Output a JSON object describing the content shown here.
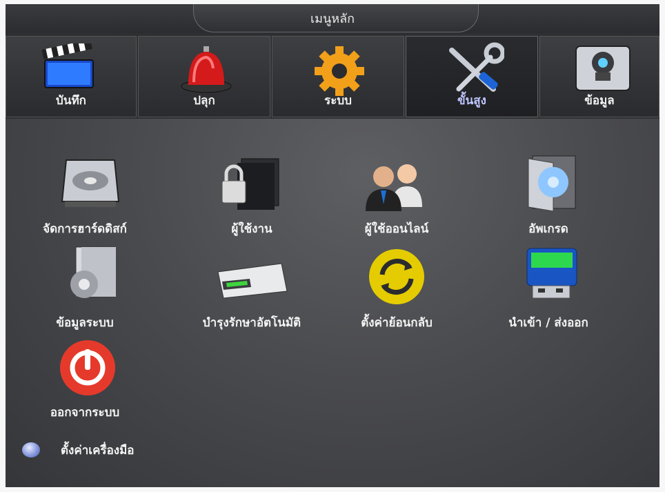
{
  "window": {
    "title": "เมนูหลัก"
  },
  "tabs": [
    {
      "label": "บันทึก",
      "icon": "clapperboard-icon"
    },
    {
      "label": "ปลุก",
      "icon": "siren-icon"
    },
    {
      "label": "ระบบ",
      "icon": "gear-icon"
    },
    {
      "label": "ขั้นสูง",
      "icon": "tools-icon",
      "active": true
    },
    {
      "label": "ข้อมูล",
      "icon": "disk-info-icon"
    }
  ],
  "items": [
    {
      "label": "จัดการฮาร์ดดิสก์",
      "icon": "hard-disk-icon"
    },
    {
      "label": "ผู้ใช้งาน",
      "icon": "lock-folder-icon"
    },
    {
      "label": "ผู้ใช้ออนไลน์",
      "icon": "users-icon"
    },
    {
      "label": "อัพเกรด",
      "icon": "cd-upgrade-icon"
    },
    {
      "label": "ข้อมูลระบบ",
      "icon": "system-info-icon"
    },
    {
      "label": "บำรุงรักษาอัตโนมัติ",
      "icon": "drive-maintenance-icon"
    },
    {
      "label": "ตั้งค่าย้อนกลับ",
      "icon": "restore-icon"
    },
    {
      "label": "นำเข้า / ส่งออก",
      "icon": "usb-drive-icon"
    },
    {
      "label": "ออกจากระบบ",
      "icon": "power-icon"
    }
  ],
  "footer": {
    "tools_label": "ตั้งค่าเครื่องมือ",
    "icon": "info-dot-icon"
  },
  "colors": {
    "active_tab_text": "#bfc7ff",
    "text": "#f4f4f4"
  }
}
